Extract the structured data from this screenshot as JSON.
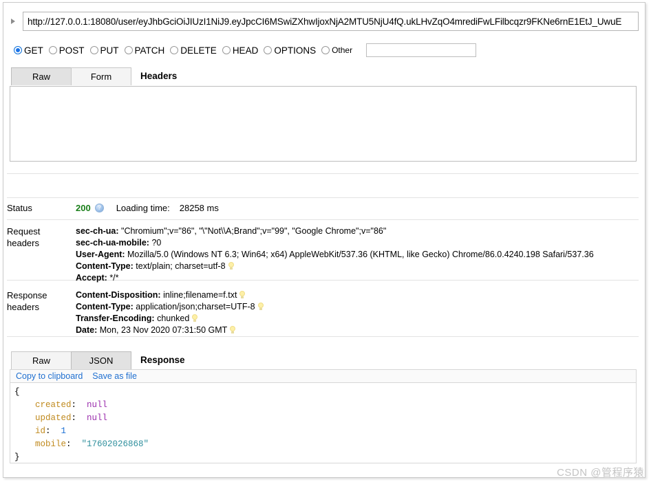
{
  "request": {
    "url": "http://127.0.0.1:18080/user/eyJhbGciOiJIUzI1NiJ9.eyJpcCI6MSwiZXhwIjoxNjA2MTU5NjU4fQ.ukLHvZqO4mrediFwLFilbcqzr9FKNe6rnE1EtJ_UwuE",
    "url_placeholder": "",
    "disclosure_icon": "triangle-right-icon",
    "methods": [
      {
        "label": "GET",
        "checked": true
      },
      {
        "label": "POST",
        "checked": false
      },
      {
        "label": "PUT",
        "checked": false
      },
      {
        "label": "PATCH",
        "checked": false
      },
      {
        "label": "DELETE",
        "checked": false
      },
      {
        "label": "HEAD",
        "checked": false
      },
      {
        "label": "OPTIONS",
        "checked": false
      },
      {
        "label": "Other",
        "checked": false
      }
    ],
    "other_method_value": "",
    "other_method_placeholder": "",
    "tabs": [
      {
        "label": "Raw",
        "selected": true
      },
      {
        "label": "Form",
        "selected": false
      }
    ],
    "tabs_title": "Headers",
    "body_value": "",
    "body_placeholder": ""
  },
  "result": {
    "status_label": "Status",
    "status_code": "200",
    "status_help_icon": "help-circle-icon",
    "loading_time_label": "Loading time:",
    "loading_time_value": "28258 ms",
    "request_headers_label_1": "Request",
    "request_headers_label_2": "headers",
    "request_headers": [
      {
        "name": "sec-ch-ua",
        "value": "\"Chromium\";v=\"86\", \"\\\"Not\\\\A;Brand\";v=\"99\", \"Google Chrome\";v=\"86\"",
        "bulb": false
      },
      {
        "name": "sec-ch-ua-mobile",
        "value": "?0",
        "bulb": false
      },
      {
        "name": "User-Agent",
        "value": "Mozilla/5.0 (Windows NT 6.3; Win64; x64) AppleWebKit/537.36 (KHTML, like Gecko) Chrome/86.0.4240.198 Safari/537.36",
        "bulb": false
      },
      {
        "name": "Content-Type",
        "value": "text/plain; charset=utf-8",
        "bulb": true
      },
      {
        "name": "Accept",
        "value": "*/*",
        "bulb": false
      }
    ],
    "response_headers_label_1": "Response",
    "response_headers_label_2": "headers",
    "response_headers": [
      {
        "name": "Content-Disposition",
        "value": "inline;filename=f.txt",
        "bulb": true
      },
      {
        "name": "Content-Type",
        "value": "application/json;charset=UTF-8",
        "bulb": true
      },
      {
        "name": "Transfer-Encoding",
        "value": "chunked",
        "bulb": true
      },
      {
        "name": "Date",
        "value": "Mon, 23 Nov 2020 07:31:50 GMT",
        "bulb": true
      }
    ]
  },
  "response": {
    "tabs": [
      {
        "label": "Raw",
        "selected": false
      },
      {
        "label": "JSON",
        "selected": true
      }
    ],
    "tabs_title": "Response",
    "copy_link": "Copy to clipboard",
    "save_link": "Save as file",
    "json_lines": [
      {
        "indent": 0,
        "type": "brace",
        "text": "{"
      },
      {
        "indent": 1,
        "type": "pair",
        "key": "created",
        "value": "null",
        "value_type": "null"
      },
      {
        "indent": 1,
        "type": "pair",
        "key": "updated",
        "value": "null",
        "value_type": "null"
      },
      {
        "indent": 1,
        "type": "pair",
        "key": "id",
        "value": "1",
        "value_type": "num"
      },
      {
        "indent": 1,
        "type": "pair",
        "key": "mobile",
        "value": "\"17602026868\"",
        "value_type": "str"
      },
      {
        "indent": 0,
        "type": "brace",
        "text": "}"
      }
    ]
  },
  "watermark": "CSDN @管程序猿",
  "colors": {
    "status_ok": "#1a7f1a",
    "link": "#1f6fd0",
    "radio_accent": "#1a73e8",
    "json_key": "#c08a1e",
    "json_null": "#9b2fae",
    "json_num": "#1a6fd4",
    "json_str": "#2f8f9d",
    "watermark": "#c3c3c3"
  }
}
